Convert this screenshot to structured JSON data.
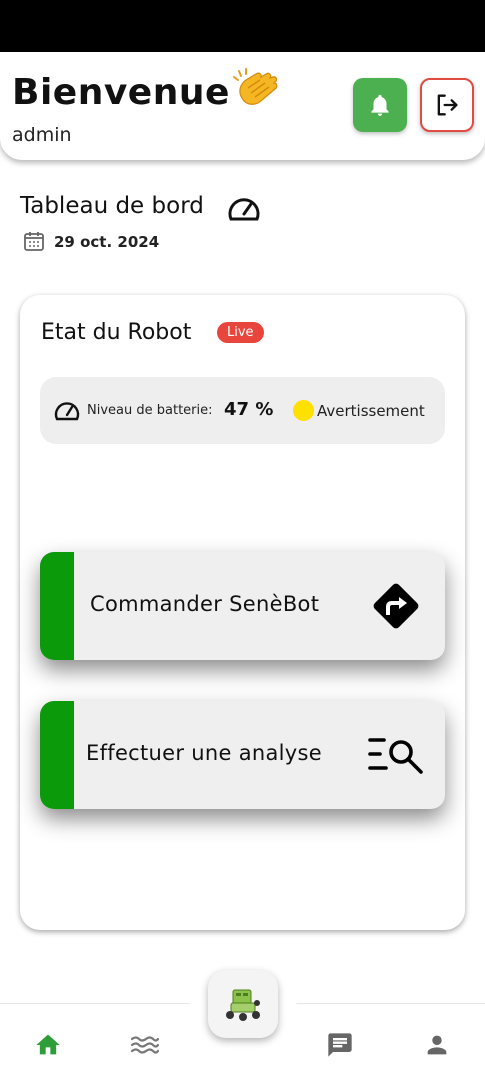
{
  "header": {
    "welcome": "Bienvenue",
    "username": "admin",
    "bell_icon": "bell-icon",
    "logout_icon": "logout-icon"
  },
  "dashboard": {
    "title": "Tableau de bord",
    "date": "29 oct. 2024"
  },
  "robot": {
    "title": "Etat du Robot",
    "live_badge": "Live",
    "battery_label": "Niveau de batterie:",
    "battery_value": "47 %",
    "battery_level": 0.47,
    "status_text": "Avertissement",
    "status_color": "#ffe000"
  },
  "actions": [
    {
      "label": "Commander SenèBot",
      "icon": "directions-icon"
    },
    {
      "label": "Effectuer une analyse",
      "icon": "search-list-icon"
    }
  ],
  "nav": {
    "items": [
      "home-icon",
      "waves-icon",
      "robot-icon",
      "chat-icon",
      "profile-icon"
    ],
    "active": "home"
  },
  "colors": {
    "accent_green": "#4caf50",
    "action_bar_green": "#0a9a0a",
    "danger_red": "#e04b42",
    "live_red": "#e8453c"
  }
}
